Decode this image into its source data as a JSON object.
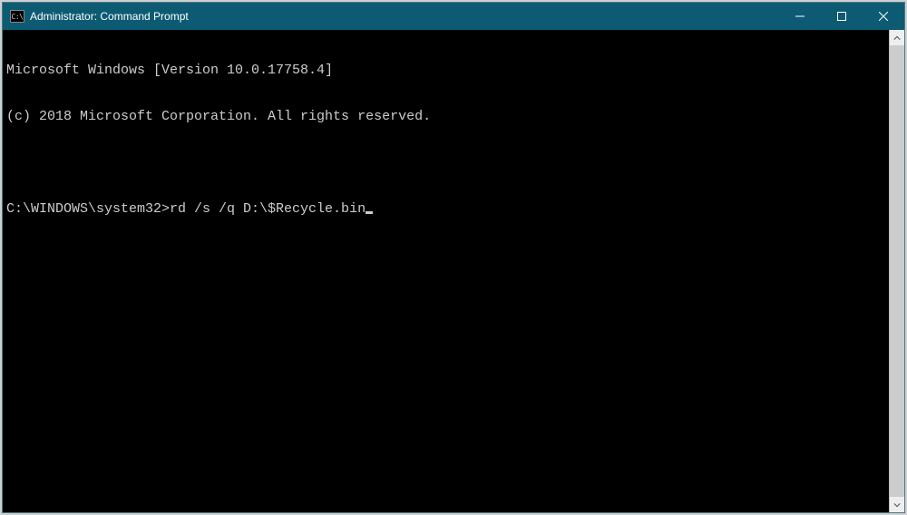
{
  "window": {
    "title": "Administrator: Command Prompt",
    "icon_label": "cmd-icon"
  },
  "terminal": {
    "lines": [
      "Microsoft Windows [Version 10.0.17758.4]",
      "(c) 2018 Microsoft Corporation. All rights reserved.",
      ""
    ],
    "prompt": "C:\\WINDOWS\\system32>",
    "command": "rd /s /q D:\\$Recycle.bin"
  }
}
